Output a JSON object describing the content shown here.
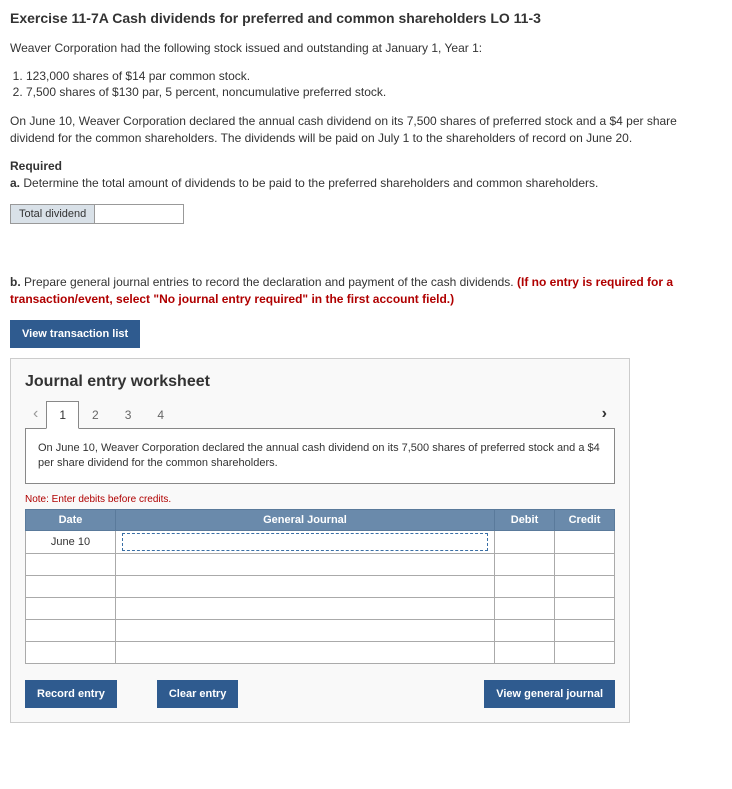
{
  "title": "Exercise 11-7A Cash dividends for preferred and common shareholders LO 11-3",
  "intro": "Weaver Corporation had the following stock issued and outstanding at January 1, Year 1:",
  "list1": "123,000 shares of $14 par common stock.",
  "list2": "7,500 shares of $130 par, 5 percent, noncumulative preferred stock.",
  "para2": "On June 10, Weaver Corporation declared the annual cash dividend on its 7,500 shares of preferred stock and a $4 per share dividend for the common shareholders. The dividends will be paid on July 1 to the shareholders of record on June 20.",
  "required_label": "Required",
  "req_a": "a.",
  "req_a_text": " Determine the total amount of dividends to be paid to the preferred shareholders and common shareholders.",
  "total_div_label": "Total dividend",
  "req_b": "b.",
  "req_b_text": " Prepare general journal entries to record the declaration and payment of the cash dividends. ",
  "req_b_red": "(If no entry is required for a transaction/event, select \"No journal entry required\" in the first account field.)",
  "view_trans_btn": "View transaction list",
  "ws_title": "Journal entry worksheet",
  "tabs": {
    "t1": "1",
    "t2": "2",
    "t3": "3",
    "t4": "4"
  },
  "tab_desc": "On June 10, Weaver Corporation declared the annual cash dividend on its 7,500 shares of preferred stock and a $4 per share dividend for the common shareholders.",
  "note": "Note: Enter debits before credits.",
  "headers": {
    "date": "Date",
    "gj": "General Journal",
    "debit": "Debit",
    "credit": "Credit"
  },
  "date_val": "June 10",
  "btns": {
    "record": "Record entry",
    "clear": "Clear entry",
    "view": "View general journal"
  }
}
